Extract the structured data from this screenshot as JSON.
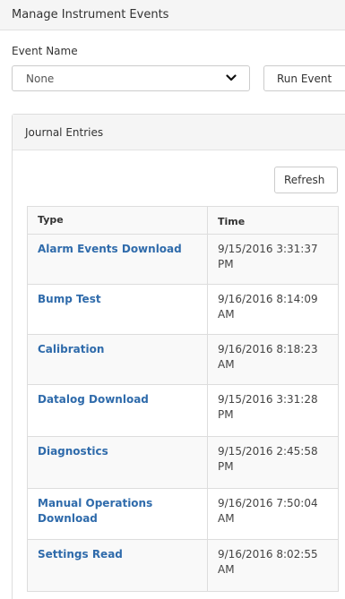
{
  "header": {
    "title": "Manage Instrument Events"
  },
  "event_form": {
    "label": "Event Name",
    "select_value": "None",
    "run_label": "Run Event"
  },
  "journal": {
    "title": "Journal Entries",
    "refresh_label": "Refresh",
    "columns": [
      "Type",
      "Time"
    ],
    "rows": [
      {
        "type": "Alarm Events Download",
        "time": "9/15/2016 3:31:37 PM"
      },
      {
        "type": "Bump Test",
        "time": "9/16/2016 8:14:09 AM"
      },
      {
        "type": "Calibration",
        "time": "9/16/2016 8:18:23 AM"
      },
      {
        "type": "Datalog Download",
        "time": "9/15/2016 3:31:28 PM"
      },
      {
        "type": "Diagnostics",
        "time": "9/15/2016 2:45:58 PM"
      },
      {
        "type": "Manual Operations Download",
        "time": "9/16/2016 7:50:04 AM"
      },
      {
        "type": "Settings Read",
        "time": "9/16/2016 8:02:55 AM"
      }
    ]
  },
  "colors": {
    "link": "#2f6bab",
    "header_bg": "#f5f5f5",
    "border": "#dddddd"
  },
  "icons": {
    "select_caret": "chevron-down-icon"
  }
}
